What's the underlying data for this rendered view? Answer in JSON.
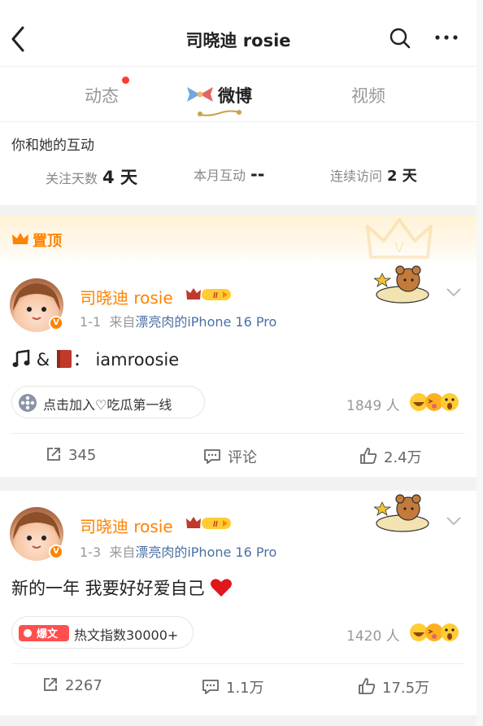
{
  "header": {
    "title": "司晓迪 rosie"
  },
  "tabs": [
    {
      "label": "动态"
    },
    {
      "label": "微博"
    },
    {
      "label": "视频"
    }
  ],
  "interaction": {
    "title": "你和她的互动",
    "stats": [
      {
        "label": "关注天数",
        "value": "4 天"
      },
      {
        "label": "本月互动",
        "value": "--"
      },
      {
        "label": "连续访问",
        "value": "2 天"
      }
    ]
  },
  "posts": [
    {
      "pinned_label": "置顶",
      "username": "司晓迪 rosie",
      "vip_level": "II",
      "date": "1-1",
      "source_prefix": "来自",
      "source": "漂亮肉的iPhone 16 Pro",
      "text_suffix": "：  iamroosie",
      "text_amp": "&",
      "pill_label": "点击加入♡吃瓜第一线",
      "reaction_count": "1849 人",
      "reposts": "345",
      "comments": "评论",
      "likes": "2.4万"
    },
    {
      "username": "司晓迪 rosie",
      "vip_level": "II",
      "date": "1-3",
      "source_prefix": "来自",
      "source": "漂亮肉的iPhone 16 Pro",
      "text": "新的一年 我要好好爱自己",
      "pill_tag": "爆文",
      "pill_label": "热文指数30000+",
      "reaction_count": "1420 人",
      "reposts": "2267",
      "comments": "1.1万",
      "likes": "17.5万"
    }
  ],
  "colors": {
    "brand_orange": "#ff8200",
    "link_blue": "#4a6fa5",
    "notify_red": "#ff3b30"
  }
}
